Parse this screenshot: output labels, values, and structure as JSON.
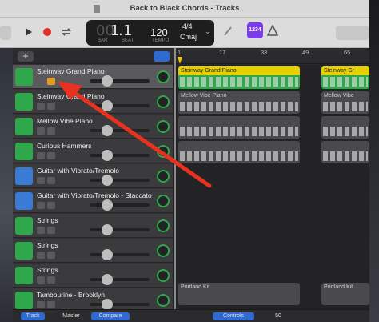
{
  "window": {
    "title": "Back to Black Chords - Tracks"
  },
  "lcd": {
    "bar": "1",
    "beat": "1",
    "bar_label": "BAR",
    "beat_label": "BEAT",
    "tempo": "120",
    "tempo_label": "TEMPO",
    "sig": "4/4",
    "key": "Cmaj"
  },
  "count_in": "1234",
  "ruler": {
    "marks": [
      "1",
      "17",
      "33",
      "49",
      "65"
    ]
  },
  "tracks": [
    {
      "name": "Steinway Grand Piano",
      "icon": "piano-icon",
      "color": "green"
    },
    {
      "name": "Steinway Grand Piano",
      "icon": "piano-icon",
      "color": "green"
    },
    {
      "name": "Mellow Vibe Piano",
      "icon": "piano-icon",
      "color": "green"
    },
    {
      "name": "Curious Hammers",
      "icon": "piano-icon",
      "color": "green"
    },
    {
      "name": "Guitar with Vibrato/Tremolo",
      "icon": "waveform-icon",
      "color": "blue"
    },
    {
      "name": "Guitar with Vibrato/Tremolo - Staccato",
      "icon": "waveform-icon",
      "color": "blue"
    },
    {
      "name": "Strings",
      "icon": "strings-icon",
      "color": "green"
    },
    {
      "name": "Strings",
      "icon": "strings-icon",
      "color": "green"
    },
    {
      "name": "Strings",
      "icon": "strings-icon",
      "color": "green"
    },
    {
      "name": "Tambourine - Brooklyn",
      "icon": "drums-icon",
      "color": "green"
    }
  ],
  "regions": {
    "r1": "Steinway Grand Piano",
    "r1b": "Steinway Gr",
    "r2": "Mellow Vibe Piano",
    "r2b": "Mellow Vibe",
    "r3": "Portland Kit",
    "r3b": "Portland Kit"
  },
  "bottom": {
    "track": "Track",
    "master": "Master",
    "compare": "Compare",
    "controls": "Controls",
    "value": "50"
  },
  "colors": {
    "accent_yellow": "#e8cf00",
    "track_green": "#2ea84a",
    "track_blue": "#3a7bd5",
    "arrow_red": "#e8321f",
    "headphone_orange": "#e49b25"
  }
}
